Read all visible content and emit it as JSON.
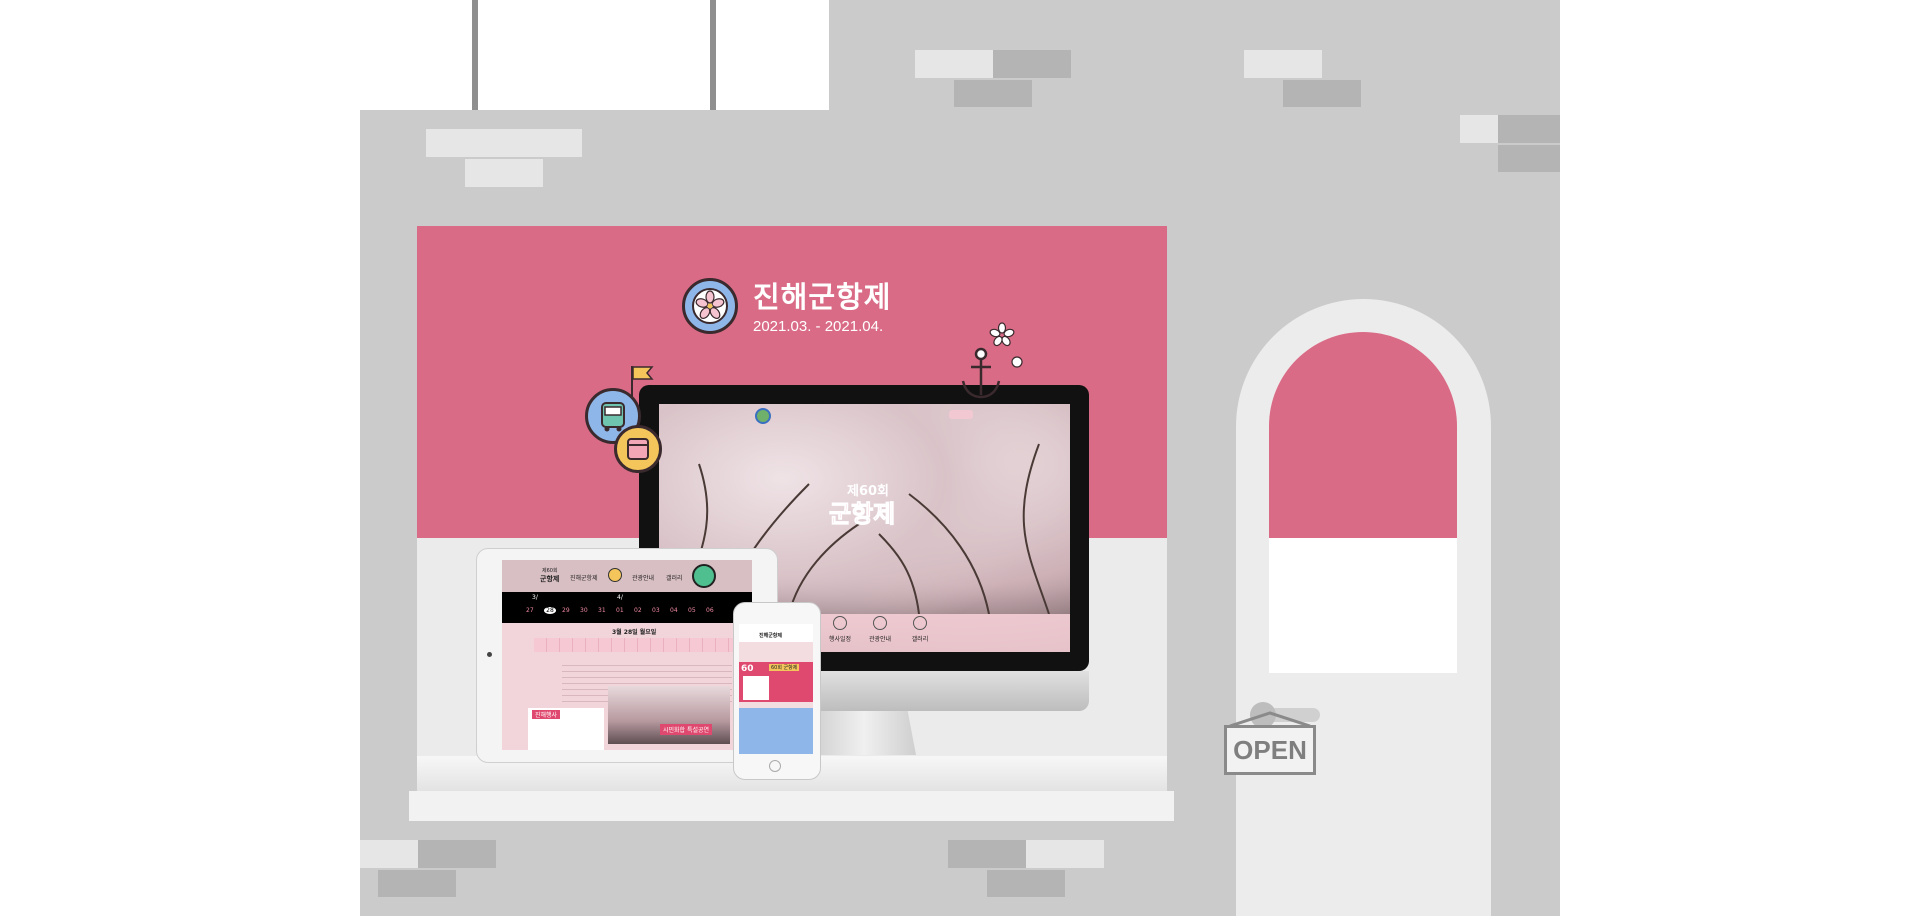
{
  "festival": {
    "title": "진해군항제",
    "dates": "2021.03. - 2021.04."
  },
  "desktop_site": {
    "edition": "제60회",
    "name": "군항제",
    "nav_items": [
      "행사일정",
      "관광안내",
      "갤러리"
    ]
  },
  "tablet_site": {
    "logo_small": "제60회",
    "logo_big": "군항제",
    "menu": [
      "진해군항제",
      "관광안내",
      "갤러리"
    ],
    "month_left": "3/",
    "month_right": "4/",
    "dates": [
      "27",
      "28",
      "29",
      "30",
      "31",
      "01",
      "02",
      "03",
      "04",
      "05",
      "06",
      "07"
    ],
    "selected_date": "3월 28일 월요일",
    "notice_title": "진해행사",
    "photo_caption": "시민화합 특설공연"
  },
  "phone_site": {
    "title": "진해군항제",
    "number": "60",
    "banner": "60회 군항제"
  },
  "sign": {
    "open_label": "OPEN"
  },
  "colors": {
    "brand_pink": "#d96b86",
    "wall_gray": "#cbcbcb",
    "icon_blue": "#8fb6e8",
    "icon_yellow": "#f4c55b"
  }
}
